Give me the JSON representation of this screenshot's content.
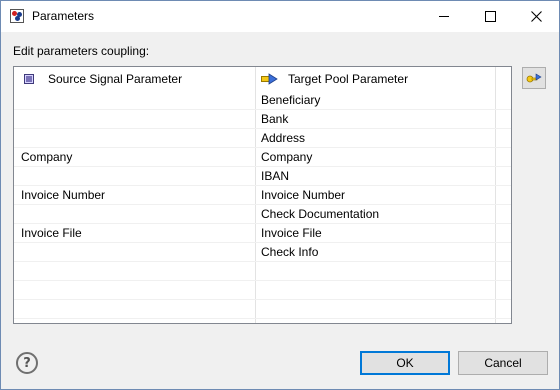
{
  "window": {
    "title": "Parameters"
  },
  "section_label": "Edit parameters coupling:",
  "table": {
    "columns": {
      "source": "Source Signal Parameter",
      "target": "Target Pool Parameter"
    },
    "rows": [
      {
        "source": "",
        "target": "Beneficiary"
      },
      {
        "source": "",
        "target": "Bank"
      },
      {
        "source": "",
        "target": "Address"
      },
      {
        "source": "Company",
        "target": "Company"
      },
      {
        "source": "",
        "target": "IBAN"
      },
      {
        "source": "Invoice Number",
        "target": "Invoice Number"
      },
      {
        "source": "",
        "target": "Check Documentation"
      },
      {
        "source": "Invoice File",
        "target": "Invoice File"
      },
      {
        "source": "",
        "target": "Check Info"
      },
      {
        "source": "",
        "target": ""
      },
      {
        "source": "",
        "target": ""
      },
      {
        "source": "",
        "target": ""
      }
    ]
  },
  "buttons": {
    "ok": "OK",
    "cancel": "Cancel",
    "help": "?"
  },
  "icons": {
    "app": "parameters-app-icon",
    "source_column": "signal-parameter-icon",
    "target_column": "pool-parameter-arrow-icon",
    "side": "key-arrow-icon"
  },
  "colors": {
    "focus_border": "#0078d7",
    "table_border": "#828790"
  }
}
